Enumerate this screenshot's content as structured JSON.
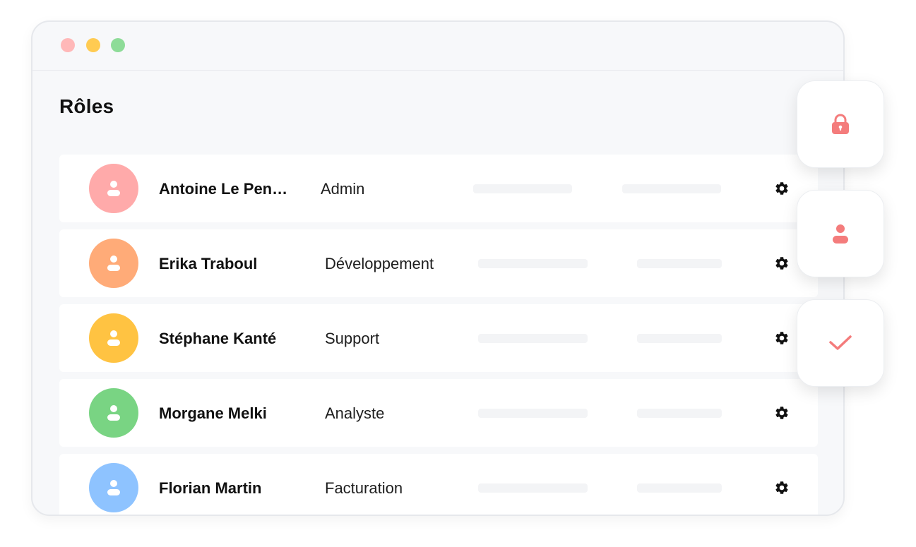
{
  "window": {
    "controls": [
      "close",
      "minimize",
      "maximize"
    ]
  },
  "page": {
    "title": "Rôles"
  },
  "colors": {
    "accent": "#f47c7c",
    "avatar_colors": [
      "#ffaaaa",
      "#ffab78",
      "#ffc342",
      "#79d483",
      "#8ec3ff"
    ]
  },
  "users": [
    {
      "name": "Antoine Le Pen…",
      "role": "Admin",
      "avatar_icon": "user-icon",
      "action_icon": "gear-icon"
    },
    {
      "name": "Erika Traboul",
      "role": "Développement",
      "avatar_icon": "user-icon",
      "action_icon": "gear-icon"
    },
    {
      "name": "Stéphane Kanté",
      "role": "Support",
      "avatar_icon": "user-icon",
      "action_icon": "gear-icon"
    },
    {
      "name": "Morgane Melki",
      "role": "Analyste",
      "avatar_icon": "user-icon",
      "action_icon": "gear-icon"
    },
    {
      "name": "Florian Martin",
      "role": "Facturation",
      "avatar_icon": "user-icon",
      "action_icon": "gear-icon"
    }
  ],
  "side_actions": [
    {
      "icon": "lock-icon"
    },
    {
      "icon": "user-icon"
    },
    {
      "icon": "check-icon"
    }
  ]
}
